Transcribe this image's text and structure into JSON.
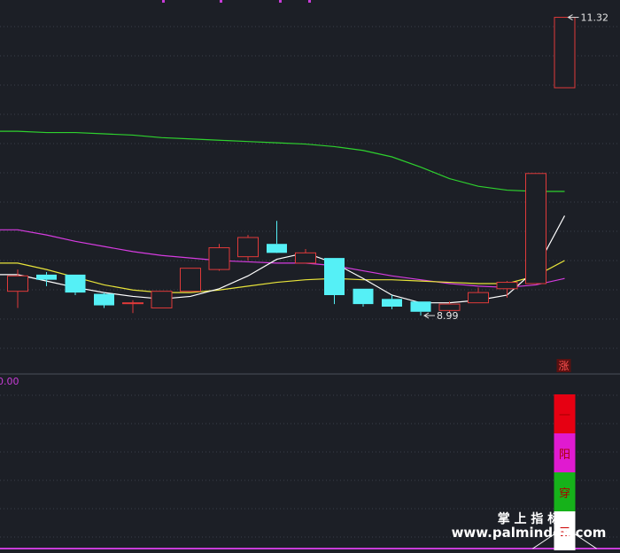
{
  "chart_data": {
    "type": "candlestick",
    "ylim": [
      8.7,
      11.4
    ],
    "y_labels": {
      "high": "11.32",
      "low": "8.99",
      "indicator_value": "0.00"
    },
    "colors": {
      "background": "#1c1f26",
      "up": "#e03a3a",
      "down": "#55f0f6",
      "grid": "#3a3f4a",
      "ma_white": "#ffffff",
      "ma_yellow": "#e8e43a",
      "ma_magenta": "#d63ce0",
      "ma_green": "#2ed12e",
      "indicator_line": "#c83cd8"
    },
    "candles": [
      {
        "o": 9.18,
        "h": 9.35,
        "l": 9.05,
        "c": 9.3
      },
      {
        "o": 9.31,
        "h": 9.33,
        "l": 9.22,
        "c": 9.27
      },
      {
        "o": 9.31,
        "h": 9.31,
        "l": 9.15,
        "c": 9.17
      },
      {
        "o": 9.16,
        "h": 9.17,
        "l": 9.05,
        "c": 9.07
      },
      {
        "o": 9.09,
        "h": 9.11,
        "l": 9.01,
        "c": 9.09
      },
      {
        "o": 9.05,
        "h": 9.18,
        "l": 9.05,
        "c": 9.18
      },
      {
        "o": 9.18,
        "h": 9.36,
        "l": 9.18,
        "c": 9.36
      },
      {
        "o": 9.35,
        "h": 9.55,
        "l": 9.34,
        "c": 9.52
      },
      {
        "o": 9.45,
        "h": 9.62,
        "l": 9.42,
        "c": 9.6
      },
      {
        "o": 9.55,
        "h": 9.73,
        "l": 9.53,
        "c": 9.48
      },
      {
        "o": 9.4,
        "h": 9.51,
        "l": 9.4,
        "c": 9.48
      },
      {
        "o": 9.44,
        "h": 9.44,
        "l": 9.08,
        "c": 9.15
      },
      {
        "o": 9.2,
        "h": 9.2,
        "l": 9.06,
        "c": 9.08
      },
      {
        "o": 9.12,
        "h": 9.15,
        "l": 9.04,
        "c": 9.06
      },
      {
        "o": 9.1,
        "h": 9.1,
        "l": 8.99,
        "c": 9.02
      },
      {
        "o": 9.03,
        "h": 9.1,
        "l": 9.01,
        "c": 9.08
      },
      {
        "o": 9.09,
        "h": 9.21,
        "l": 9.09,
        "c": 9.17
      },
      {
        "o": 9.2,
        "h": 9.26,
        "l": 9.13,
        "c": 9.25
      },
      {
        "o": 9.24,
        "h": 10.1,
        "l": 9.24,
        "c": 10.1
      },
      {
        "o": 10.77,
        "h": 11.32,
        "l": 10.77,
        "c": 11.32
      }
    ],
    "ma_white": [
      9.31,
      9.26,
      9.21,
      9.17,
      9.14,
      9.12,
      9.14,
      9.2,
      9.3,
      9.43,
      9.48,
      9.4,
      9.28,
      9.15,
      9.09,
      9.09,
      9.11,
      9.15,
      9.35,
      9.77
    ],
    "ma_yellow": [
      9.4,
      9.35,
      9.29,
      9.23,
      9.19,
      9.17,
      9.17,
      9.19,
      9.22,
      9.25,
      9.27,
      9.28,
      9.27,
      9.27,
      9.26,
      9.25,
      9.24,
      9.24,
      9.3,
      9.42
    ],
    "ma_magenta": [
      9.66,
      9.62,
      9.57,
      9.53,
      9.49,
      9.46,
      9.44,
      9.42,
      9.41,
      9.4,
      9.4,
      9.38,
      9.34,
      9.3,
      9.27,
      9.24,
      9.22,
      9.21,
      9.23,
      9.28
    ],
    "ma_green": [
      10.43,
      10.42,
      10.42,
      10.41,
      10.4,
      10.38,
      10.37,
      10.36,
      10.35,
      10.34,
      10.33,
      10.31,
      10.28,
      10.23,
      10.15,
      10.06,
      10.0,
      9.97,
      9.96,
      9.96
    ],
    "badge_label": "涨",
    "indicator": {
      "stack": [
        {
          "label": "一",
          "color": "#e60012"
        },
        {
          "label": "阳",
          "color": "#e01ad0"
        },
        {
          "label": "穿",
          "color": "#16b21a"
        },
        {
          "label": "三",
          "color": "#ffffff"
        }
      ]
    }
  },
  "watermark": {
    "cn": "掌 上 指 标",
    "url": "www.palmindex.com"
  }
}
